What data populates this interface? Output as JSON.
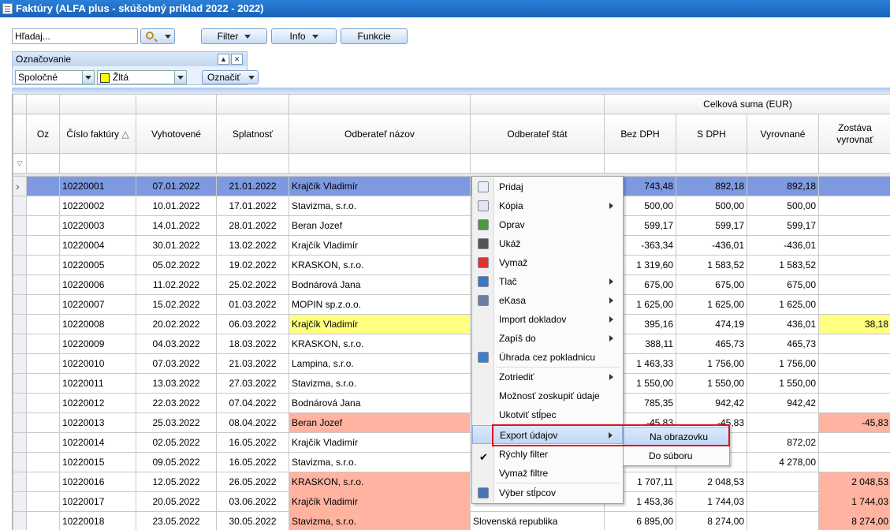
{
  "window": {
    "title": "Faktúry (ALFA plus - skúšobný príklad 2022 - 2022)"
  },
  "toolbar": {
    "search_placeholder": "Hľadaj...",
    "filter_label": "Filter",
    "info_label": "Info",
    "functions_label": "Funkcie"
  },
  "marking": {
    "title": "Označovanie",
    "scope_value": "Spoločné",
    "color_value": "Žltá",
    "mark_button": "Označiť"
  },
  "grid": {
    "group_header": "Celková suma (EUR)",
    "columns": [
      "Oz",
      "Číslo faktúry",
      "Vyhotovené",
      "Splatnosť",
      "Odberateľ názov",
      "Odberateľ štát",
      "Bez DPH",
      "S DPH",
      "Vyrovnané",
      "Zostáva vyrovnať"
    ],
    "sort_indicator": "△",
    "rows": [
      {
        "no": "10220001",
        "vyh": "07.01.2022",
        "spl": "21.01.2022",
        "name": "Krajčík Vladimír",
        "state": "",
        "bez": "743,48",
        "s": "892,18",
        "vyr": "892,18",
        "zost": "",
        "style": "sel"
      },
      {
        "no": "10220002",
        "vyh": "10.01.2022",
        "spl": "17.01.2022",
        "name": "Stavizma, s.r.o.",
        "state": "",
        "bez": "500,00",
        "s": "500,00",
        "vyr": "500,00",
        "zost": "",
        "style": ""
      },
      {
        "no": "10220003",
        "vyh": "14.01.2022",
        "spl": "28.01.2022",
        "name": "Beran Jozef",
        "state": "",
        "bez": "599,17",
        "s": "599,17",
        "vyr": "599,17",
        "zost": "",
        "style": ""
      },
      {
        "no": "10220004",
        "vyh": "30.01.2022",
        "spl": "13.02.2022",
        "name": "Krajčík Vladimír",
        "state": "",
        "bez": "-363,34",
        "s": "-436,01",
        "vyr": "-436,01",
        "zost": "",
        "style": ""
      },
      {
        "no": "10220005",
        "vyh": "05.02.2022",
        "spl": "19.02.2022",
        "name": "KRASKON, s.r.o.",
        "state": "",
        "bez": "1 319,60",
        "s": "1 583,52",
        "vyr": "1 583,52",
        "zost": "",
        "style": ""
      },
      {
        "no": "10220006",
        "vyh": "11.02.2022",
        "spl": "25.02.2022",
        "name": "Bodnárová Jana",
        "state": "",
        "bez": "675,00",
        "s": "675,00",
        "vyr": "675,00",
        "zost": "",
        "style": ""
      },
      {
        "no": "10220007",
        "vyh": "15.02.2022",
        "spl": "01.03.2022",
        "name": "MOPIN sp.z.o.o.",
        "state": "",
        "bez": "1 625,00",
        "s": "1 625,00",
        "vyr": "1 625,00",
        "zost": "",
        "style": ""
      },
      {
        "no": "10220008",
        "vyh": "20.02.2022",
        "spl": "06.03.2022",
        "name": "Krajčík Vladimír",
        "state": "",
        "bez": "395,16",
        "s": "474,19",
        "vyr": "436,01",
        "zost": "38,18",
        "style": "yl"
      },
      {
        "no": "10220009",
        "vyh": "04.03.2022",
        "spl": "18.03.2022",
        "name": "KRASKON, s.r.o.",
        "state": "",
        "bez": "388,11",
        "s": "465,73",
        "vyr": "465,73",
        "zost": "",
        "style": ""
      },
      {
        "no": "10220010",
        "vyh": "07.03.2022",
        "spl": "21.03.2022",
        "name": "Lampina, s.r.o.",
        "state": "",
        "bez": "1 463,33",
        "s": "1 756,00",
        "vyr": "1 756,00",
        "zost": "",
        "style": ""
      },
      {
        "no": "10220011",
        "vyh": "13.03.2022",
        "spl": "27.03.2022",
        "name": "Stavizma, s.r.o.",
        "state": "",
        "bez": "1 550,00",
        "s": "1 550,00",
        "vyr": "1 550,00",
        "zost": "",
        "style": ""
      },
      {
        "no": "10220012",
        "vyh": "22.03.2022",
        "spl": "07.04.2022",
        "name": "Bodnárová Jana",
        "state": "",
        "bez": "785,35",
        "s": "942,42",
        "vyr": "942,42",
        "zost": "",
        "style": ""
      },
      {
        "no": "10220013",
        "vyh": "25.03.2022",
        "spl": "08.04.2022",
        "name": "Beran Jozef",
        "state": "",
        "bez": "-45,83",
        "s": "-45,83",
        "vyr": "",
        "zost": "-45,83",
        "style": "sal"
      },
      {
        "no": "10220014",
        "vyh": "02.05.2022",
        "spl": "16.05.2022",
        "name": "Krajčík Vladimír",
        "state": "",
        "bez": "",
        "s": "",
        "vyr": "872,02",
        "zost": "",
        "style": ""
      },
      {
        "no": "10220015",
        "vyh": "09.05.2022",
        "spl": "16.05.2022",
        "name": "Stavizma, s.r.o.",
        "state": "",
        "bez": "",
        "s": "",
        "vyr": "4 278,00",
        "zost": "",
        "style": ""
      },
      {
        "no": "10220016",
        "vyh": "12.05.2022",
        "spl": "26.05.2022",
        "name": "KRASKON, s.r.o.",
        "state": "",
        "bez": "1 707,11",
        "s": "2 048,53",
        "vyr": "",
        "zost": "2 048,53",
        "style": "sal"
      },
      {
        "no": "10220017",
        "vyh": "20.05.2022",
        "spl": "03.06.2022",
        "name": "Krajčík Vladimír",
        "state": "",
        "bez": "1 453,36",
        "s": "1 744,03",
        "vyr": "",
        "zost": "1 744,03",
        "style": "sal"
      },
      {
        "no": "10220018",
        "vyh": "23.05.2022",
        "spl": "30.05.2022",
        "name": "Stavizma, s.r.o.",
        "state": "Slovenská republika",
        "bez": "6 895,00",
        "s": "8 274,00",
        "vyr": "",
        "zost": "8 274,00",
        "style": "sal"
      }
    ]
  },
  "context_menu": {
    "items": [
      {
        "label": "Pridaj",
        "icon": "add-document-icon",
        "submenu": false
      },
      {
        "label": "Kópia",
        "icon": "copy-icon",
        "submenu": true
      },
      {
        "label": "Oprav",
        "icon": "edit-pencil-icon",
        "submenu": false
      },
      {
        "label": "Ukáž",
        "icon": "view-binoculars-icon",
        "submenu": false
      },
      {
        "label": "Vymaž",
        "icon": "delete-icon",
        "submenu": false
      },
      {
        "label": "Tlač",
        "icon": "printer-icon",
        "submenu": true
      },
      {
        "label": "eKasa",
        "icon": "cash-register-icon",
        "submenu": true
      },
      {
        "label": "Import dokladov",
        "icon": "",
        "submenu": true
      },
      {
        "label": "Zapíš do",
        "icon": "",
        "submenu": true
      },
      {
        "label": "Úhrada cez pokladnicu",
        "icon": "payment-pen-icon",
        "submenu": false
      },
      {
        "label": "Zotriediť",
        "icon": "",
        "submenu": true
      },
      {
        "label": "Možnosť zoskupiť údaje",
        "icon": "",
        "submenu": false
      },
      {
        "label": "Ukotviť stĺpec",
        "icon": "",
        "submenu": false
      },
      {
        "label": "Export údajov",
        "icon": "",
        "submenu": true
      },
      {
        "label": "Rýchly filter",
        "icon": "checkmark-icon",
        "submenu": false
      },
      {
        "label": "Vymaž filtre",
        "icon": "",
        "submenu": false
      },
      {
        "label": "Výber stĺpcov",
        "icon": "columns-icon",
        "submenu": false
      }
    ],
    "export_submenu": [
      "Na obrazovku",
      "Do súboru"
    ]
  },
  "colors": {
    "selected_row": "#7d99e0",
    "yellow_mark": "#ffff80",
    "salmon_mark": "#ffb3a0",
    "highlight": "#e01020"
  }
}
